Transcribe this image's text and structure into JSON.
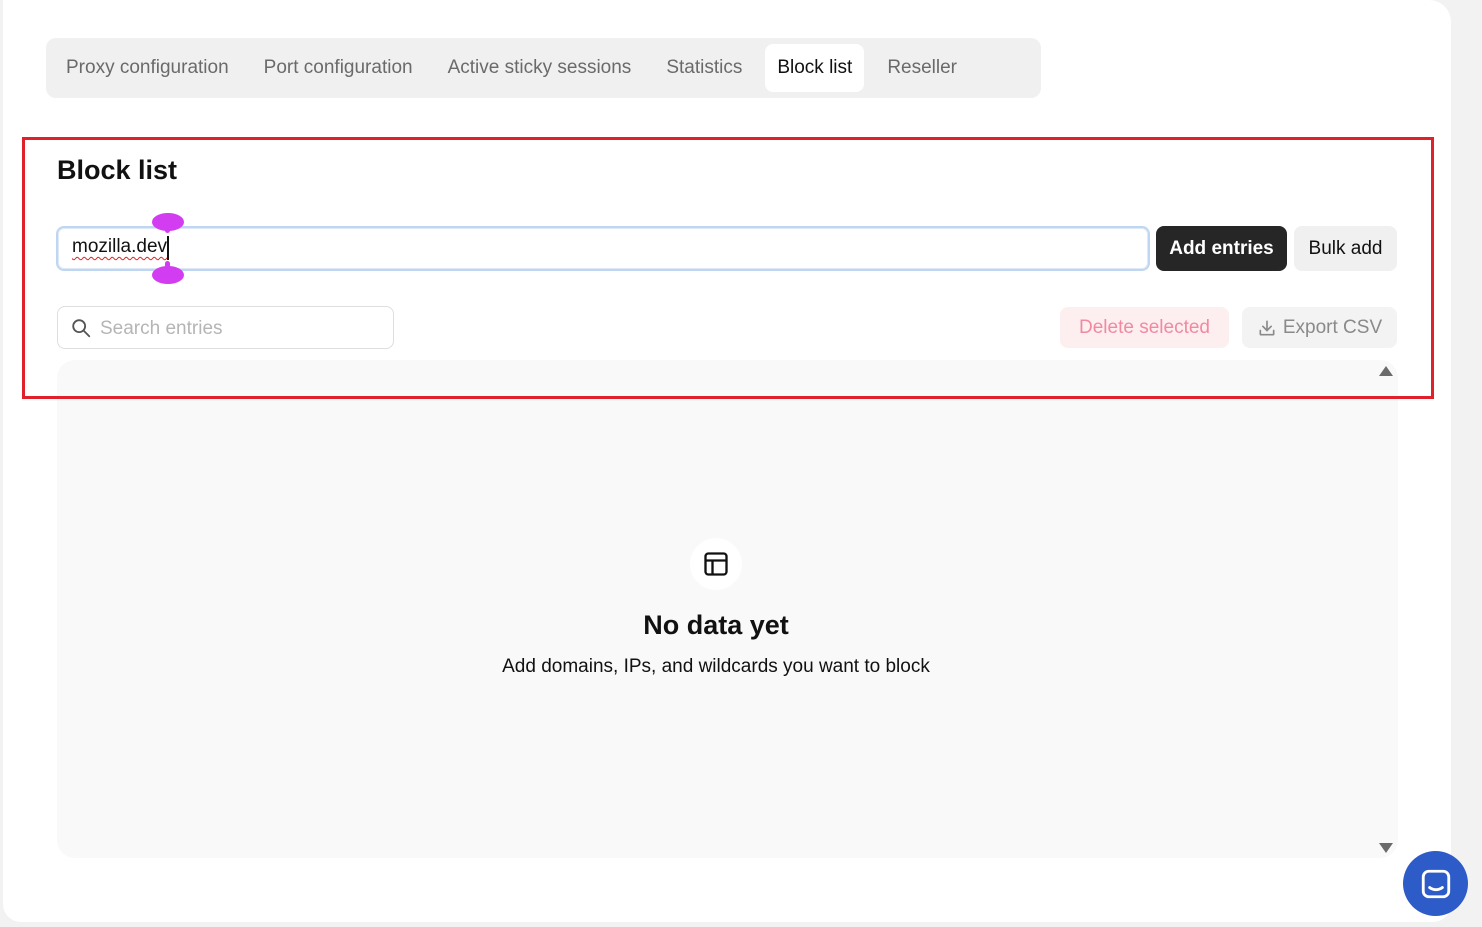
{
  "tabs": [
    {
      "label": "Proxy configuration",
      "active": false
    },
    {
      "label": "Port configuration",
      "active": false
    },
    {
      "label": "Active sticky sessions",
      "active": false
    },
    {
      "label": "Statistics",
      "active": false
    },
    {
      "label": "Block list",
      "active": true
    },
    {
      "label": "Reseller",
      "active": false
    }
  ],
  "block_list": {
    "title": "Block list",
    "entry_input_value": "mozilla.dev",
    "add_entries_label": "Add entries",
    "bulk_add_label": "Bulk add",
    "search_placeholder": "Search entries",
    "delete_selected_label": "Delete selected",
    "export_csv_label": "Export CSV"
  },
  "empty_state": {
    "icon": "layout-panel-icon",
    "title": "No data yet",
    "subtitle": "Add domains, IPs, and wildcards you want to block"
  },
  "colors": {
    "highlight_border": "#e0202a",
    "primary_button": "#262626",
    "chat_button": "#2d5bc7",
    "delete_text": "#f08aa0"
  }
}
